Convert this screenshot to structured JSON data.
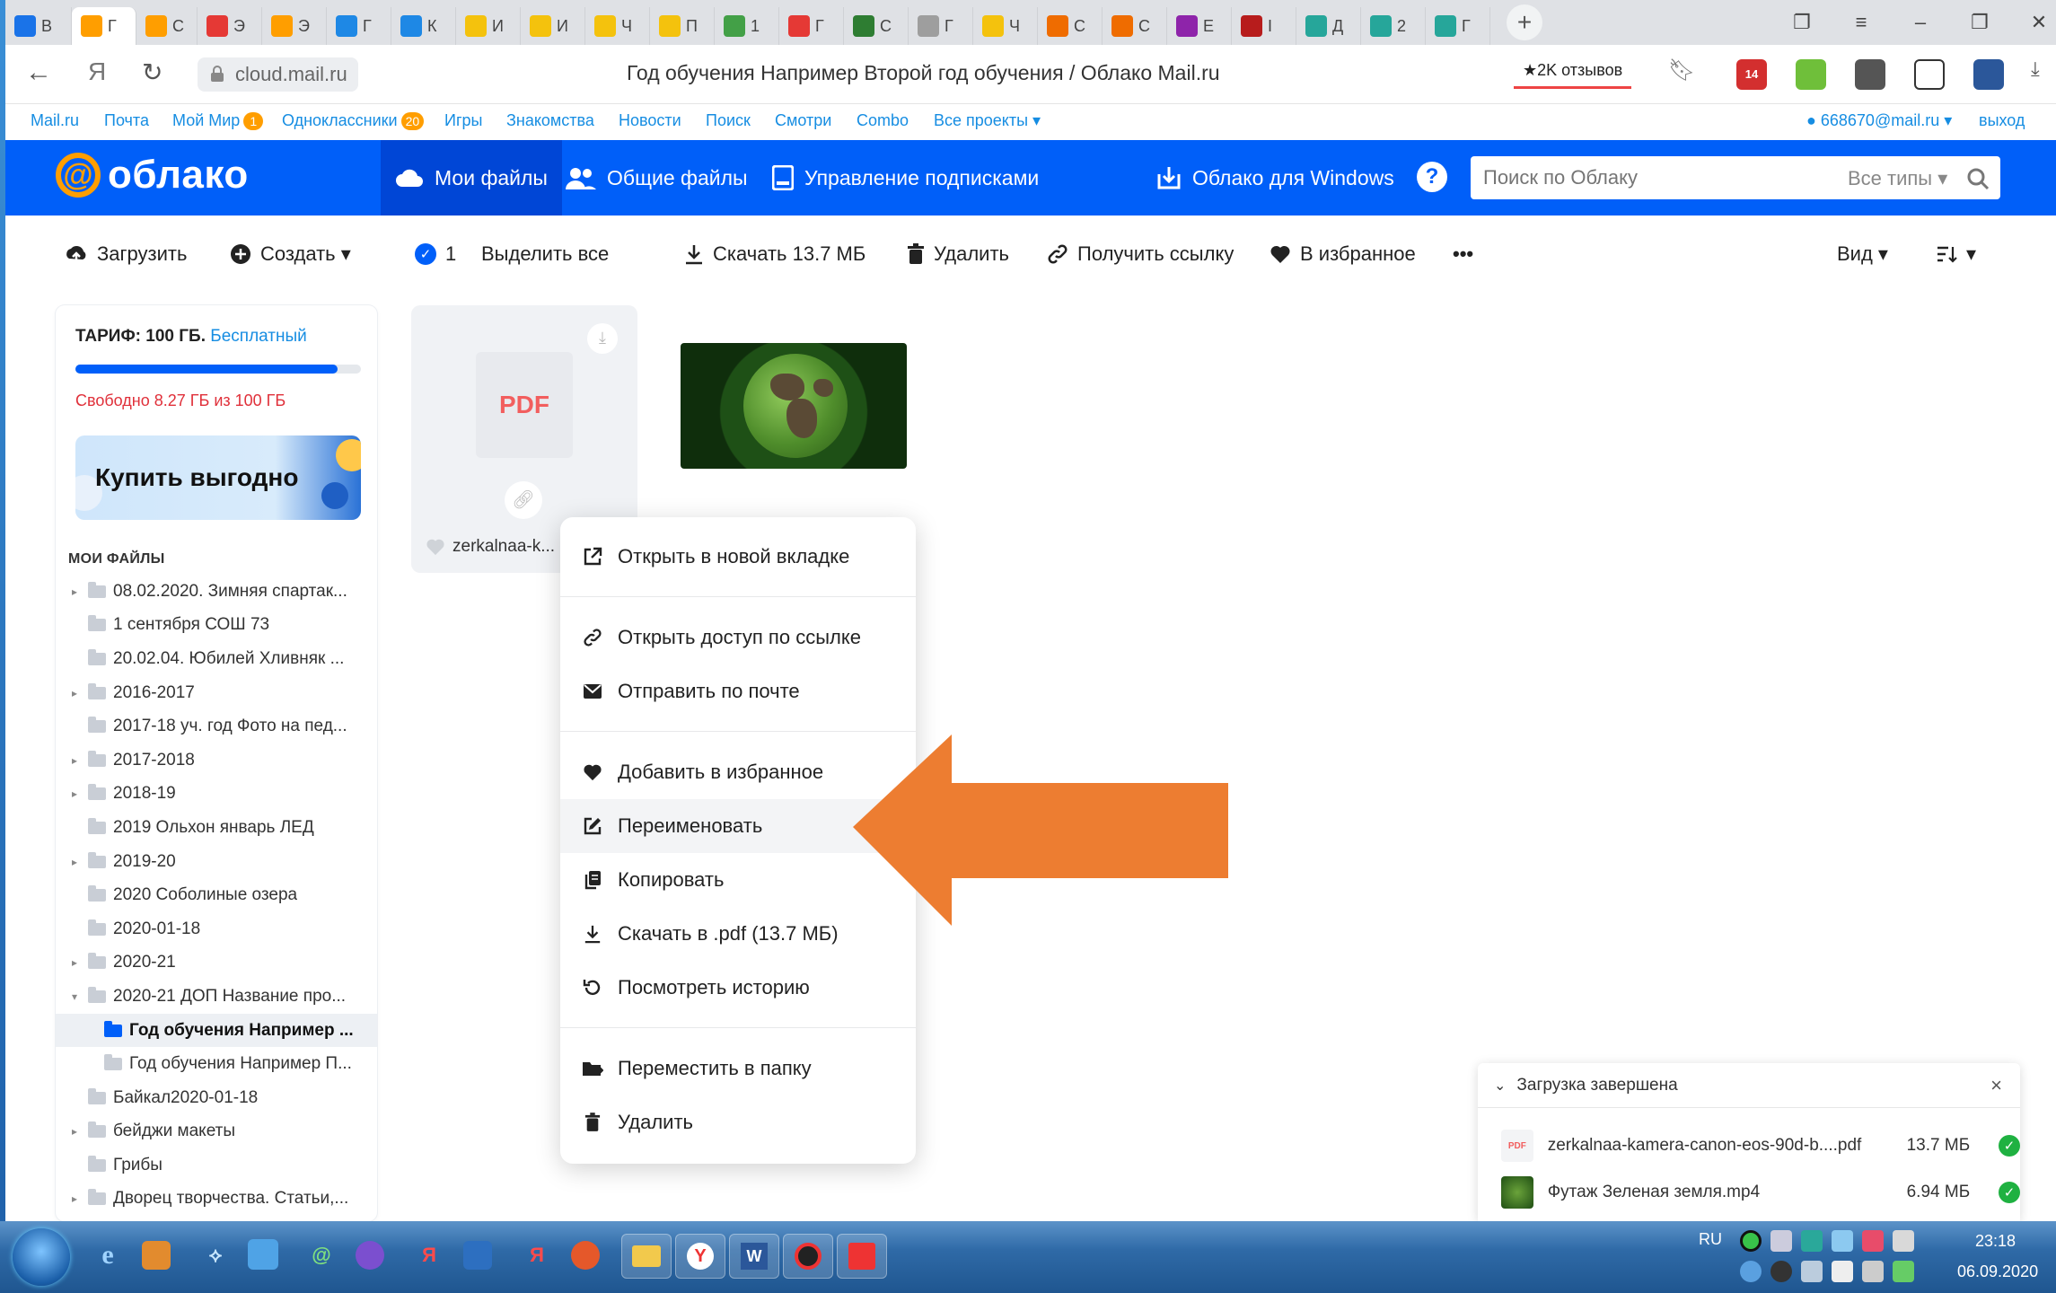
{
  "browser": {
    "tabs": [
      {
        "label": "В",
        "color": "#1a73e8"
      },
      {
        "label": "Г",
        "color": "#ff9e00",
        "active": true
      },
      {
        "label": "С",
        "color": "#ff9e00"
      },
      {
        "label": "Э",
        "color": "#e53935"
      },
      {
        "label": "Э",
        "color": "#ff9e00"
      },
      {
        "label": "Г",
        "color": "#1e88e5"
      },
      {
        "label": "К",
        "color": "#1e88e5"
      },
      {
        "label": "И",
        "color": "#f4c20d"
      },
      {
        "label": "И",
        "color": "#f4c20d"
      },
      {
        "label": "Ч",
        "color": "#f4c20d"
      },
      {
        "label": "П",
        "color": "#f4c20d"
      },
      {
        "label": "1",
        "color": "#43a047"
      },
      {
        "label": "Г",
        "color": "#e53935"
      },
      {
        "label": "С",
        "color": "#2e7d32"
      },
      {
        "label": "Г",
        "color": "#9e9e9e"
      },
      {
        "label": "Ч",
        "color": "#f4c20d"
      },
      {
        "label": "С",
        "color": "#ef6c00"
      },
      {
        "label": "С",
        "color": "#ef6c00"
      },
      {
        "label": "Е",
        "color": "#8e24aa"
      },
      {
        "label": "I",
        "color": "#b71c1c"
      },
      {
        "label": "Д",
        "color": "#26a69a"
      },
      {
        "label": "2",
        "color": "#26a69a"
      },
      {
        "label": "Г",
        "color": "#26a69a"
      }
    ],
    "url": "cloud.mail.ru",
    "page_title": "Год обучения Например Второй год обучения / Облако Mail.ru",
    "reviews": "★2K отзывов",
    "ext_badge": "14"
  },
  "portal": {
    "links": [
      "Mail.ru",
      "Почта",
      "Мой Мир",
      "Одноклассники",
      "Игры",
      "Знакомства",
      "Новости",
      "Поиск",
      "Смотри",
      "Combo",
      "Все проекты ▾"
    ],
    "moi_mir_badge": "1",
    "ok_badge": "20",
    "user": "● 668670@mail.ru ▾",
    "logout": "выход"
  },
  "header": {
    "logo_text": "облако",
    "nav": [
      "Мои файлы",
      "Общие файлы",
      "Управление подписками",
      "Облако для Windows"
    ],
    "help": "?",
    "search_placeholder": "Поиск по Облаку",
    "search_types": "Все типы ▾"
  },
  "toolbar": {
    "upload": "Загрузить",
    "create": "Создать ▾",
    "selected_count": "1",
    "select_all": "Выделить все",
    "download": "Скачать 13.7 МБ",
    "delete": "Удалить",
    "get_link": "Получить ссылку",
    "favorite": "В избранное",
    "more": "•••",
    "view": "Вид ▾",
    "sort": "▾"
  },
  "sidebar": {
    "tariff_label": "ТАРИФ: 100 ГБ.",
    "tariff_plan": "Бесплатный",
    "quota_used_fraction": 0.917,
    "free_text": "Свободно 8.27 ГБ из 100 ГБ",
    "buy_label": "Купить выгодно",
    "section_title": "МОИ ФАЙЛЫ",
    "tree": [
      {
        "label": "08.02.2020. Зимняя спартак...",
        "caret": "▸",
        "level": 0
      },
      {
        "label": "1 сентября СОШ 73",
        "caret": "",
        "level": 0
      },
      {
        "label": "20.02.04. Юбилей Хливняк ...",
        "caret": "",
        "level": 0
      },
      {
        "label": "2016-2017",
        "caret": "▸",
        "level": 0
      },
      {
        "label": "2017-18 уч. год Фото на пед...",
        "caret": "",
        "level": 0
      },
      {
        "label": "2017-2018",
        "caret": "▸",
        "level": 0
      },
      {
        "label": "2018-19",
        "caret": "▸",
        "level": 0
      },
      {
        "label": "2019 Ольхон январь ЛЕД",
        "caret": "",
        "level": 0
      },
      {
        "label": "2019-20",
        "caret": "▸",
        "level": 0
      },
      {
        "label": "2020 Соболиные озера",
        "caret": "",
        "level": 0
      },
      {
        "label": "2020-01-18",
        "caret": "",
        "level": 0
      },
      {
        "label": "2020-21",
        "caret": "▸",
        "level": 0
      },
      {
        "label": "2020-21 ДОП Название про...",
        "caret": "▾",
        "level": 0
      },
      {
        "label": "Год обучения Например ...",
        "caret": "",
        "level": 1,
        "selected": true
      },
      {
        "label": "Год обучения Например П...",
        "caret": "",
        "level": 1
      },
      {
        "label": "Байкал2020-01-18",
        "caret": "",
        "level": 0
      },
      {
        "label": "бейджи макеты",
        "caret": "▸",
        "level": 0
      },
      {
        "label": "Грибы",
        "caret": "",
        "level": 0
      },
      {
        "label": "Дворец творчества. Статьи,...",
        "caret": "▸",
        "level": 0
      }
    ]
  },
  "files": {
    "pdf_label": "PDF",
    "pdf_name": "zerkalnaa-k..."
  },
  "context_menu": {
    "items": [
      "Открыть в новой вкладке",
      "Открыть доступ по ссылке",
      "Отправить по почте",
      "Добавить в избранное",
      "Переименовать",
      "Копировать",
      "Скачать в .pdf (13.7 МБ)",
      "Посмотреть историю",
      "Переместить в папку",
      "Удалить"
    ],
    "highlighted": "Переименовать"
  },
  "upload_panel": {
    "title": "Загрузка завершена",
    "close": "×",
    "rows": [
      {
        "icon": "PDF",
        "name": "zerkalnaa-kamera-canon-eos-90d-b....pdf",
        "size": "13.7 МБ"
      },
      {
        "icon": "",
        "name": "Футаж Зеленая земля.mp4",
        "size": "6.94 МБ"
      }
    ]
  },
  "taskbar": {
    "lang": "RU",
    "time": "23:18",
    "date": "06.09.2020"
  },
  "colors": {
    "brand_blue": "#005ff9",
    "accent_orange": "#ff9e00",
    "arrow_orange": "#ed7d31",
    "warn_red": "#e0303a",
    "ok_green": "#1fb141"
  }
}
